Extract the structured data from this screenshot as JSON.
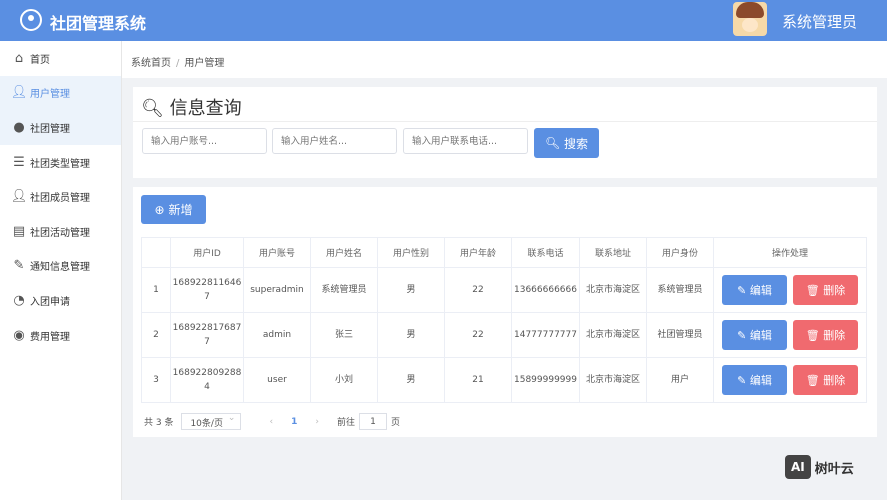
{
  "header": {
    "title": "社团管理系统",
    "user": "系统管理员"
  },
  "sidebar": {
    "items": [
      {
        "label": "首页",
        "icon": "home-icon"
      },
      {
        "label": "用户管理",
        "icon": "user-icon"
      },
      {
        "label": "社团管理",
        "icon": "drop-icon"
      },
      {
        "label": "社团类型管理",
        "icon": "list-icon"
      },
      {
        "label": "社团成员管理",
        "icon": "members-icon"
      },
      {
        "label": "社团活动管理",
        "icon": "clipboard-icon"
      },
      {
        "label": "通知信息管理",
        "icon": "edit-note-icon"
      },
      {
        "label": "入团申请",
        "icon": "apply-icon"
      },
      {
        "label": "费用管理",
        "icon": "fee-icon"
      }
    ]
  },
  "breadcrumb": {
    "home": "系统首页",
    "current": "用户管理"
  },
  "search": {
    "title": "信息查询",
    "account_placeholder": "输入用户账号...",
    "name_placeholder": "输入用户姓名...",
    "phone_placeholder": "输入用户联系电话...",
    "button": "搜索"
  },
  "toolbar": {
    "add": "新增"
  },
  "table": {
    "headers": [
      "",
      "用户ID",
      "用户账号",
      "用户姓名",
      "用户性别",
      "用户年龄",
      "联系电话",
      "联系地址",
      "用户身份",
      "操作处理"
    ],
    "rows": [
      {
        "idx": "1",
        "id": "1689228116467",
        "account": "superadmin",
        "name": "系统管理员",
        "gender": "男",
        "age": "22",
        "phone": "13666666666",
        "address": "北京市海淀区",
        "role": "系统管理员"
      },
      {
        "idx": "2",
        "id": "1689228176877",
        "account": "admin",
        "name": "张三",
        "gender": "男",
        "age": "22",
        "phone": "14777777777",
        "address": "北京市海淀区",
        "role": "社团管理员"
      },
      {
        "idx": "3",
        "id": "1689228092884",
        "account": "user",
        "name": "小刘",
        "gender": "男",
        "age": "21",
        "phone": "15899999999",
        "address": "北京市海淀区",
        "role": "用户"
      }
    ],
    "edit": "编辑",
    "delete": "删除"
  },
  "pagination": {
    "total": "共 3 条",
    "page_size": "10条/页",
    "current": "1",
    "goto_label": "前往",
    "goto_value": "1",
    "page_suffix": "页"
  },
  "watermark": {
    "ai": "AI",
    "brand": "树叶云"
  }
}
